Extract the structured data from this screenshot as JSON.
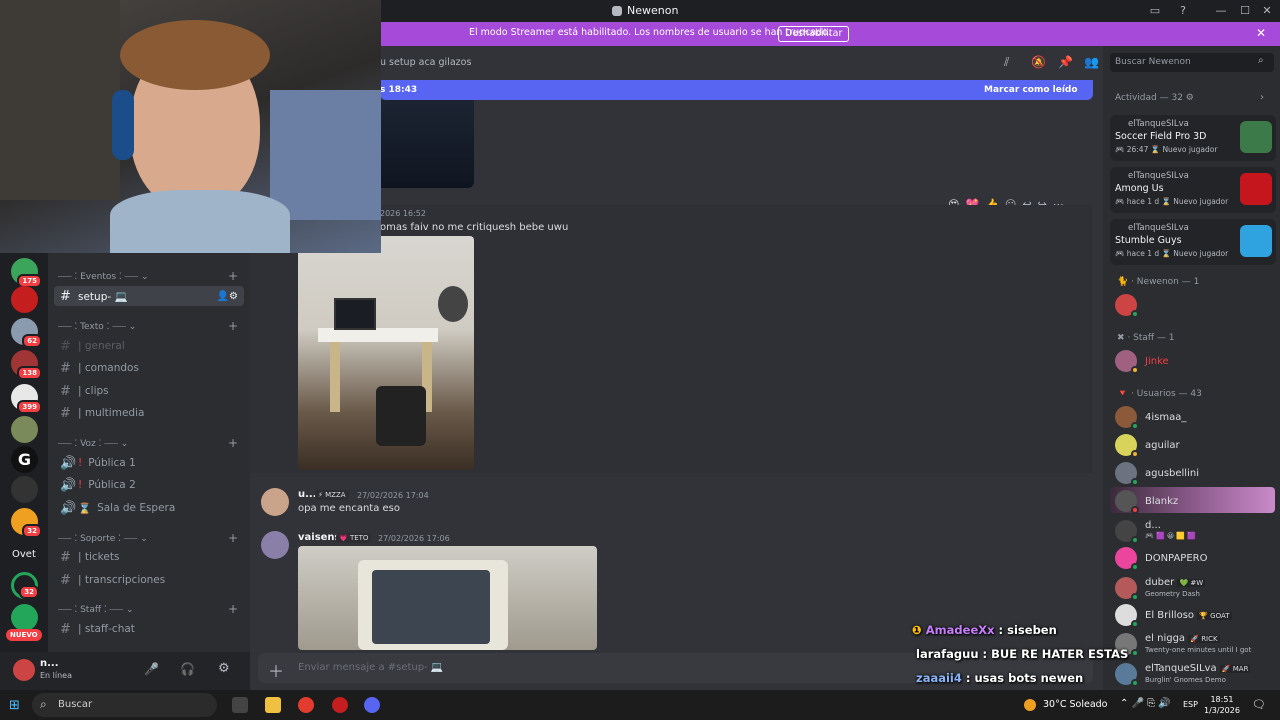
{
  "window": {
    "title": "Newenon"
  },
  "banner": {
    "message": "El modo Streamer está habilitado. Los nombres de usuario se han truncado.",
    "button": "Deshabilitar"
  },
  "rail": {
    "badges": [
      "175",
      "62",
      "138",
      "399",
      "32",
      "32"
    ],
    "ovet": "Ovet",
    "nuevo": "NUEVO"
  },
  "channels": {
    "categories": [
      {
        "label": "⎯⎯⎯ ⁚ Eventos ⁚ ⎯⎯⎯"
      },
      {
        "label": "⎯⎯⎯ ⁚ Texto ⁚ ⎯⎯⎯"
      },
      {
        "label": "⎯⎯⎯ ⁚ Voz ⁚ ⎯⎯⎯"
      },
      {
        "label": "⎯⎯⎯ ⁚ Soporte ⁚ ⎯⎯⎯"
      },
      {
        "label": "⎯⎯⎯ ⁚ Staff ⁚ ⎯⎯⎯"
      }
    ],
    "items": [
      {
        "label": "setup- 💻"
      },
      {
        "label": "| general"
      },
      {
        "label": "| comandos"
      },
      {
        "label": "| clips"
      },
      {
        "label": "| multimedia"
      },
      {
        "label": "Pública 1"
      },
      {
        "label": "Pública 2"
      },
      {
        "label": "Sala de Espera"
      },
      {
        "label": "| tickets"
      },
      {
        "label": "| transcripciones"
      },
      {
        "label": "| staff-chat"
      }
    ]
  },
  "user": {
    "name": "n...",
    "status": "En línea"
  },
  "chat": {
    "header_topic": "u setup aca gilazos",
    "new_since": "s 18:43",
    "mark_read": "Marcar como leído",
    "messages": [
      {
        "time": "2026 16:52",
        "text": "omas faiv no me critiquesh bebe uwu"
      },
      {
        "author": "u...",
        "tag": "⚡ MZZA",
        "time": "27/02/2026 17:04",
        "text": "opa me encanta eso"
      },
      {
        "author": "vaisens",
        "tag": "💗 TETO",
        "time": "27/02/2026 17:06"
      }
    ],
    "composer_placeholder": "Enviar mensaje a #setup- 💻"
  },
  "members": {
    "search_placeholder": "Buscar Newenon",
    "activity_header": "Actividad — 32 ⚙",
    "activities": [
      {
        "user": "elTanqueSILva",
        "game": "Soccer Field Pro 3D",
        "status": "🎮 26:47  ⌛ Nuevo jugador",
        "color": "#3d7a4a"
      },
      {
        "user": "elTanqueSILva",
        "game": "Among Us",
        "status": "🎮 hace 1 d  ⌛ Nuevo jugador",
        "color": "#c5161d"
      },
      {
        "user": "elTanqueSILva",
        "game": "Stumble Guys",
        "status": "🎮 hace 1 d  ⌛ Nuevo jugador",
        "color": "#2fa3e0"
      }
    ],
    "sections": [
      {
        "label": "Newenon — 1"
      },
      {
        "label": "Staff — 1"
      },
      {
        "label": "Usuarios — 43"
      }
    ],
    "staff_member": "Jinke",
    "users": [
      {
        "name": "4ismaa_",
        "color": "#8a5a3b"
      },
      {
        "name": "aguilar",
        "color": "#d8d35a"
      },
      {
        "name": "agusbellini",
        "color": "#6b7280"
      },
      {
        "name": "Blankz",
        "color": "#555"
      },
      {
        "name": "d...",
        "sub": "🎮 🟪 😀 🟨 🟪",
        "color": "#444"
      },
      {
        "name": "DONPAPERO",
        "color": "#eb459e"
      },
      {
        "name": "duber",
        "tag": "💚 #W",
        "sub": "Geometry Dash",
        "color": "#b45a5a"
      },
      {
        "name": "El Brilloso",
        "tag": "🏆 GOAT",
        "color": "#ddd"
      },
      {
        "name": "el nigga",
        "tag": "🚀 RICK",
        "sub": "Twenty-one minutes until I got",
        "color": "#777"
      },
      {
        "name": "elTanqueSILva",
        "tag": "🚀 MAR",
        "sub": "Burglin' Gnomes Demo",
        "color": "#5a7a9a"
      }
    ]
  },
  "overlay_chat": [
    {
      "user": "AmadeeXx",
      "text": "siseben",
      "color": "#c77dff"
    },
    {
      "user": "larafaguu",
      "text": "BUE RE HATER ESTAS",
      "color": "#ffffff"
    },
    {
      "user": "zaaaii4",
      "text": "usas bots newen",
      "color": "#8ab4f8"
    }
  ],
  "taskbar": {
    "search": "Buscar",
    "weather": "30°C  Soleado",
    "lang": "ESP",
    "time": "18:51",
    "date": "1/3/2026"
  }
}
